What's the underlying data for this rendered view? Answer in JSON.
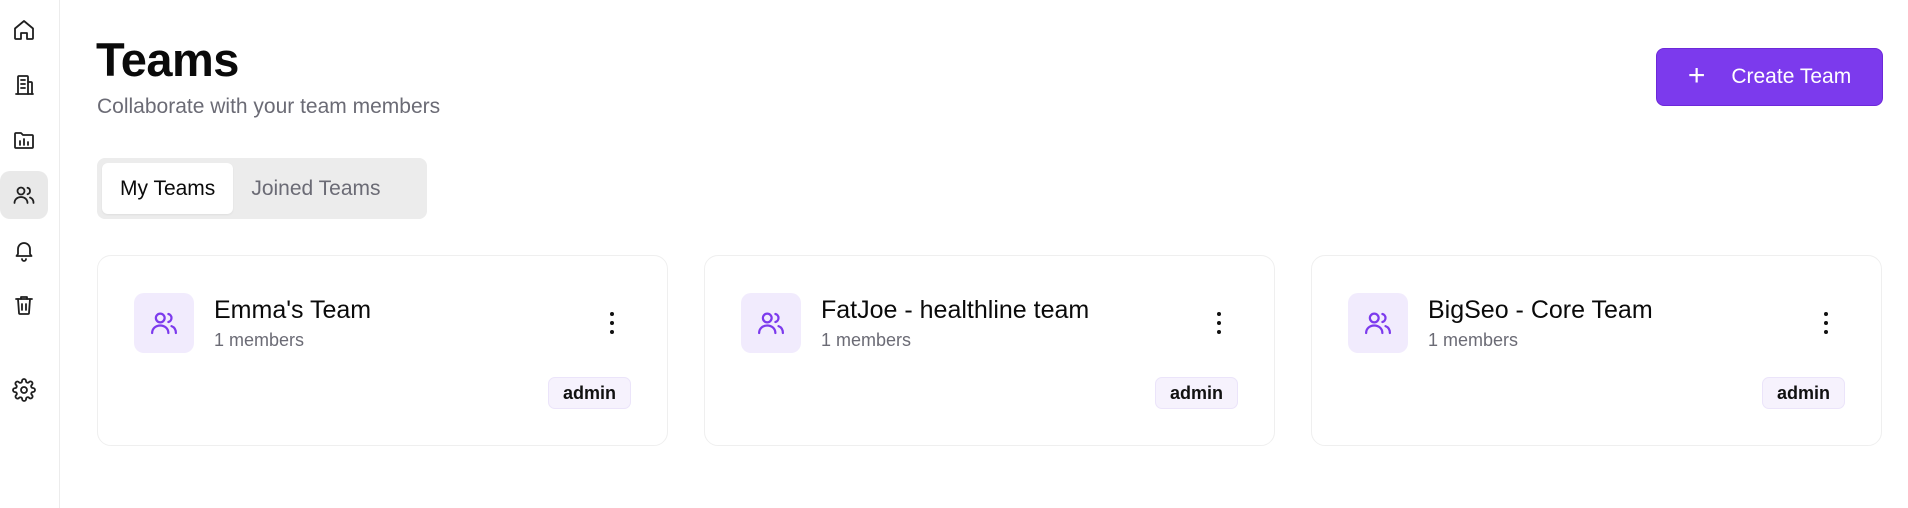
{
  "sidebar": {
    "items": [
      {
        "name": "home",
        "icon": "home-icon",
        "active": false
      },
      {
        "name": "building",
        "icon": "building-icon",
        "active": false
      },
      {
        "name": "projects",
        "icon": "folder-chart-icon",
        "active": false
      },
      {
        "name": "teams",
        "icon": "users-icon",
        "active": true
      },
      {
        "name": "notifications",
        "icon": "bell-icon",
        "active": false
      },
      {
        "name": "trash",
        "icon": "trash-icon",
        "active": false
      },
      {
        "name": "settings",
        "icon": "gear-icon",
        "active": false
      }
    ]
  },
  "header": {
    "title": "Teams",
    "subtitle": "Collaborate with your team members",
    "create_button": {
      "icon": "plus-icon",
      "label": "Create Team"
    }
  },
  "tabs": [
    {
      "label": "My Teams",
      "active": true
    },
    {
      "label": "Joined Teams",
      "active": false
    }
  ],
  "teams": [
    {
      "name": "Emma's Team",
      "members": "1 members",
      "role": "admin"
    },
    {
      "name": "FatJoe - healthline team",
      "members": "1 members",
      "role": "admin"
    },
    {
      "name": "BigSeo - Core Team",
      "members": "1 members",
      "role": "admin"
    }
  ],
  "colors": {
    "accent": "#7c3aed",
    "icon_bg": "#f1ebfd",
    "badge_bg": "#f6f2fd",
    "muted_text": "#6b6b75"
  }
}
